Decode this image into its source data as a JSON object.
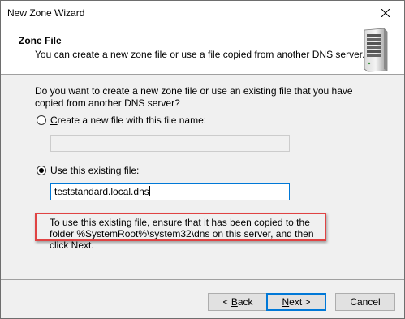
{
  "window": {
    "title": "New Zone Wizard"
  },
  "header": {
    "title": "Zone File",
    "subtitle": "You can create a new zone file or use a file copied from another DNS server."
  },
  "content": {
    "question": "Do you want to create a new zone file or use an existing file that you have copied from another DNS server?",
    "options": [
      {
        "label_accel": "C",
        "label_rest": "reate a new file with this file name:",
        "selected": false,
        "field_value": ""
      },
      {
        "label_accel": "U",
        "label_rest": "se this existing file:",
        "selected": true,
        "field_value": "teststandard.local.dns"
      }
    ],
    "note": "To use this existing file, ensure that it has been copied to the folder %SystemRoot%\\system32\\dns on this server, and then click Next.",
    "note_highlight_color": "#e04343"
  },
  "buttons": {
    "back_prefix": "< ",
    "back_accel": "B",
    "back_rest": "ack",
    "next_accel": "N",
    "next_rest": "ext >",
    "cancel": "Cancel"
  },
  "icons": {
    "close": "close-icon",
    "server": "server-icon"
  }
}
